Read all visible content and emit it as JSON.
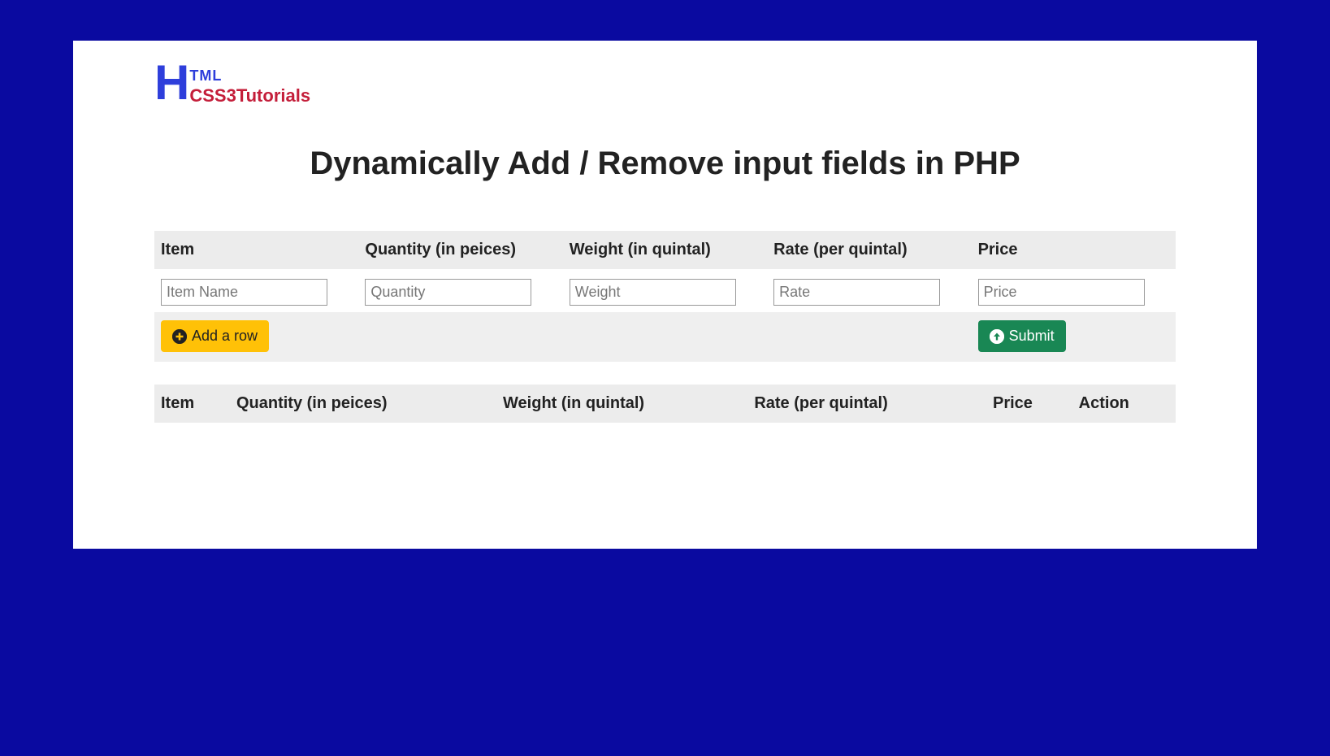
{
  "logo": {
    "letter": "H",
    "tml": "TML",
    "css3": "CSS3Tutorials"
  },
  "title": "Dynamically Add / Remove input fields in PHP",
  "form_table": {
    "headers": {
      "item": "Item",
      "quantity": "Quantity (in peices)",
      "weight": "Weight (in quintal)",
      "rate": "Rate (per quintal)",
      "price": "Price"
    },
    "placeholders": {
      "item": "Item Name",
      "quantity": "Quantity",
      "weight": "Weight",
      "rate": "Rate",
      "price": "Price"
    },
    "values": {
      "item": "",
      "quantity": "",
      "weight": "",
      "rate": "",
      "price": ""
    }
  },
  "buttons": {
    "add_row": "Add a row",
    "submit": "Submit"
  },
  "display_table": {
    "headers": {
      "item": "Item",
      "quantity": "Quantity (in peices)",
      "weight": "Weight (in quintal)",
      "rate": "Rate (per quintal)",
      "price": "Price",
      "action": "Action"
    }
  }
}
